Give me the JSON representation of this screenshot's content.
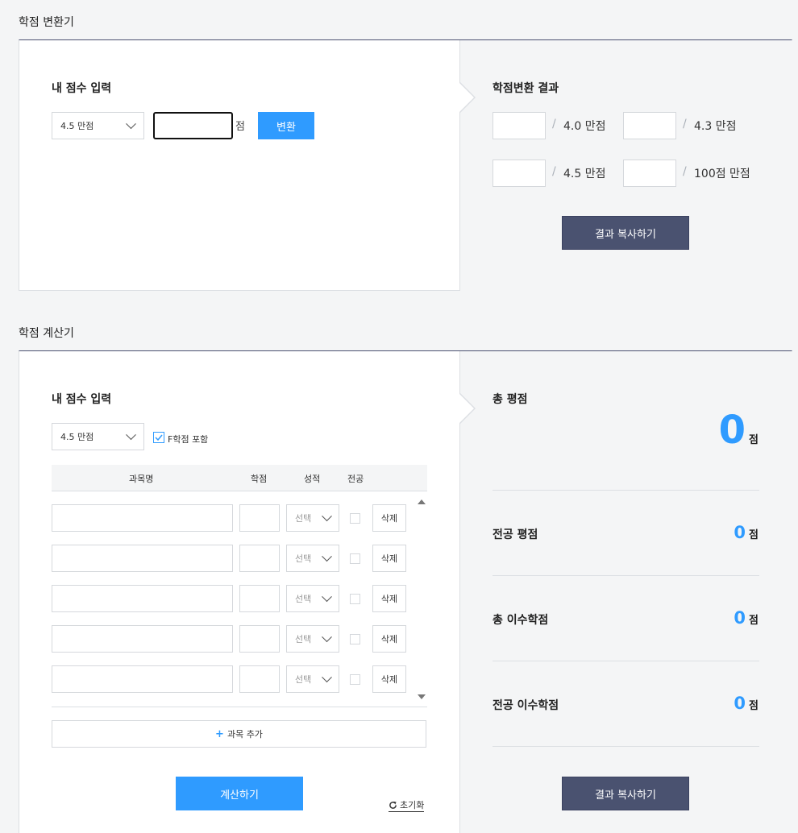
{
  "converter": {
    "section_title": "학점 변환기",
    "input_heading": "내 점수 입력",
    "scale_select": "4.5 만점",
    "score_value": "",
    "score_unit": "점",
    "convert_button": "변환",
    "result_heading": "학점변환 결과",
    "results": [
      {
        "value": "",
        "label": "4.0 만점"
      },
      {
        "value": "",
        "label": "4.3 만점"
      },
      {
        "value": "",
        "label": "4.5 만점"
      },
      {
        "value": "",
        "label": "100점 만점"
      }
    ],
    "slash": "/",
    "copy_button": "결과 복사하기"
  },
  "calculator": {
    "section_title": "학점 계산기",
    "input_heading": "내 점수 입력",
    "scale_select": "4.5 만점",
    "include_f_label": "F학점 포함",
    "include_f_checked": true,
    "columns": [
      "과목명",
      "학점",
      "성적",
      "전공"
    ],
    "rows": [
      {
        "name": "",
        "credit": "",
        "grade": "선택",
        "major": false,
        "delete": "삭제"
      },
      {
        "name": "",
        "credit": "",
        "grade": "선택",
        "major": false,
        "delete": "삭제"
      },
      {
        "name": "",
        "credit": "",
        "grade": "선택",
        "major": false,
        "delete": "삭제"
      },
      {
        "name": "",
        "credit": "",
        "grade": "선택",
        "major": false,
        "delete": "삭제"
      },
      {
        "name": "",
        "credit": "",
        "grade": "선택",
        "major": false,
        "delete": "삭제"
      }
    ],
    "add_subject": "과목 추가",
    "calculate_button": "계산하기",
    "reset_button": "초기화",
    "summary": {
      "total_gpa_label": "총 평점",
      "total_gpa_value": "0",
      "major_gpa_label": "전공 평점",
      "major_gpa_value": "0",
      "total_credits_label": "총 이수학점",
      "total_credits_value": "0",
      "major_credits_label": "전공 이수학점",
      "major_credits_value": "0",
      "unit": "점"
    },
    "copy_button": "결과 복사하기"
  },
  "colors": {
    "accent": "#2f9bff",
    "dark": "#4a5270"
  }
}
